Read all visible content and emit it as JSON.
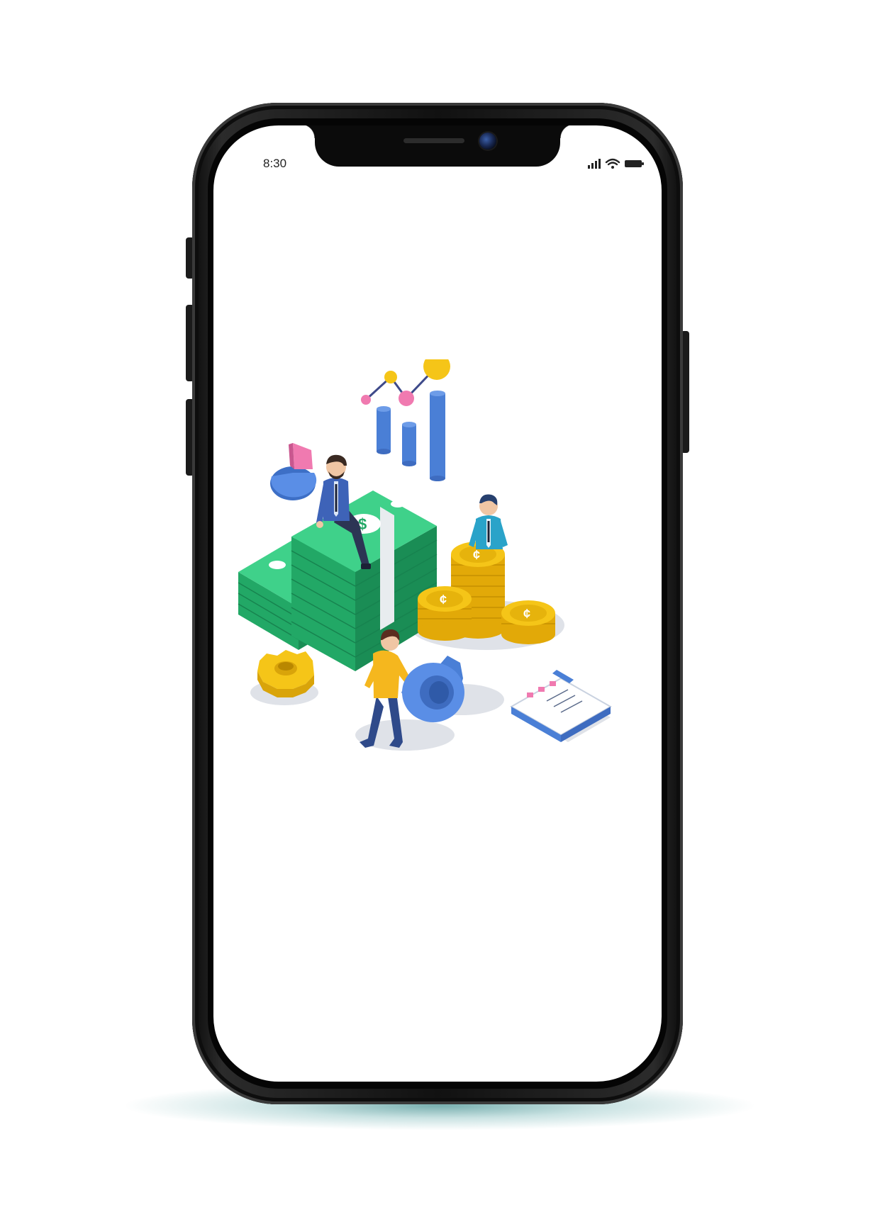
{
  "status_bar": {
    "time": "8:30",
    "icons": [
      "signal-icon",
      "wifi-icon",
      "battery-icon"
    ]
  },
  "illustration": {
    "subject": "finance-team-isometric",
    "currency_symbol": "$",
    "coin_symbol": "¢"
  },
  "colors": {
    "phone_frame": "#111111",
    "screen": "#ffffff",
    "money_green": "#2dbb73",
    "coin_gold": "#f5c518",
    "chart_blue": "#4a7fd6",
    "accent_pink": "#f07ab0",
    "floor_shadow": "#d9dde3",
    "base_glow": "#0e7070"
  }
}
